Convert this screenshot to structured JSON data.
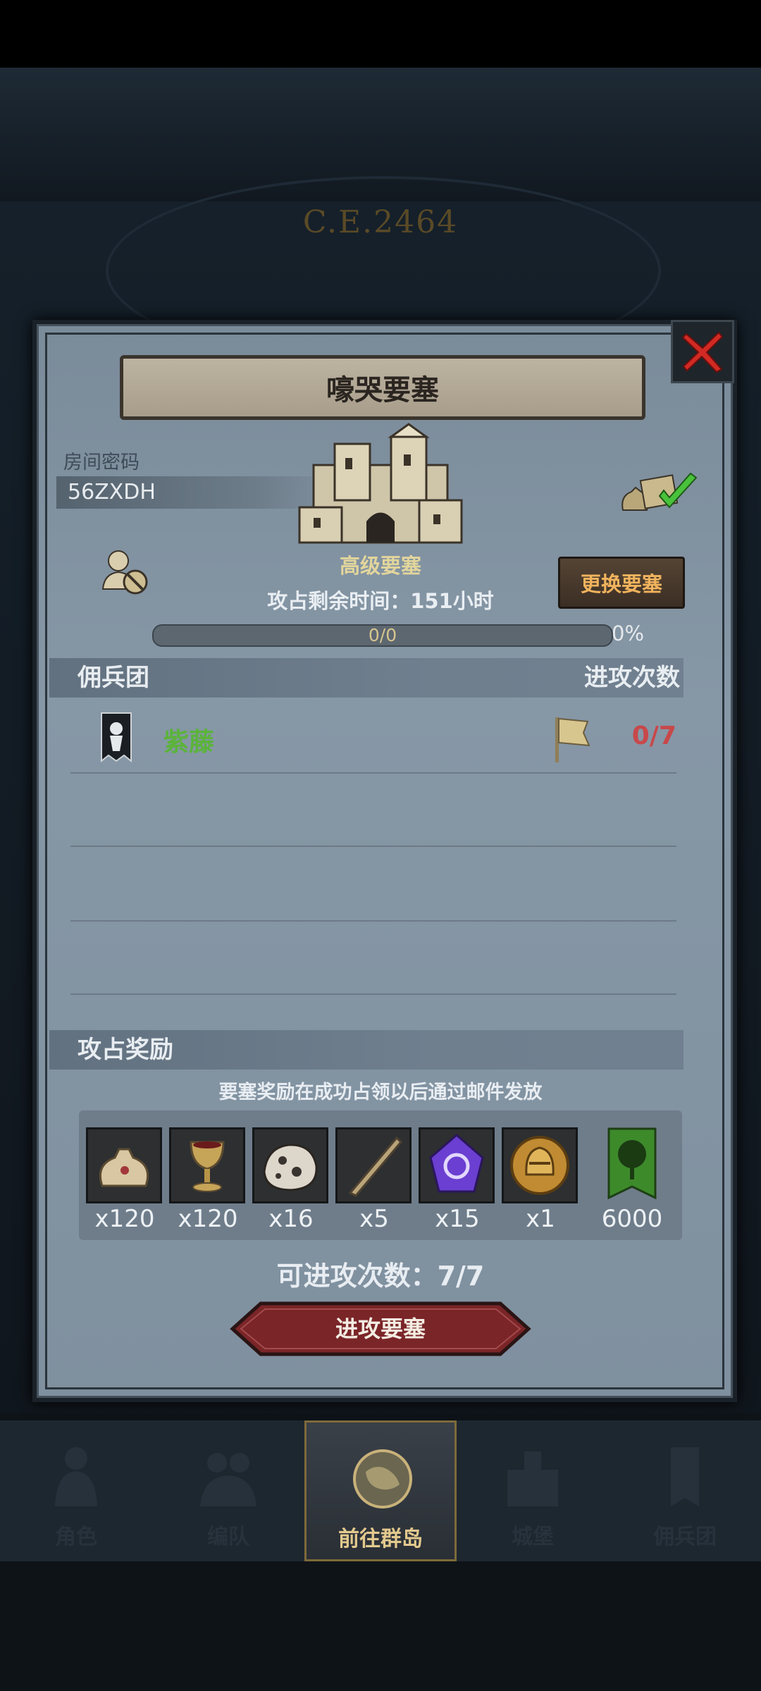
{
  "era": "C.E.2464",
  "dialog": {
    "title": "嚎哭要塞",
    "room_label": "房间密码",
    "room_code": "56ZXDH",
    "fort_level": "高级要塞",
    "remaining_time": "攻占剩余时间：151小时",
    "progress_text": "0/0",
    "progress_percent": "0%",
    "progress_value": 0,
    "change_button": "更换要塞",
    "mercenary_header": "佣兵团",
    "attacks_header": "进攻次数",
    "mercenary": {
      "name": "紫藤",
      "count": "0/7"
    },
    "reward_header": "攻占奖励",
    "reward_note": "要塞奖励在成功占领以后通过邮件发放",
    "rewards": [
      {
        "icon": "sack-icon",
        "qty": "x120"
      },
      {
        "icon": "goblet-icon",
        "qty": "x120"
      },
      {
        "icon": "ore-icon",
        "qty": "x16"
      },
      {
        "icon": "horn-icon",
        "qty": "x5"
      },
      {
        "icon": "purple-crystal-icon",
        "qty": "x15"
      },
      {
        "icon": "helmet-coin-icon",
        "qty": "x1"
      },
      {
        "icon": "tree-banner-icon",
        "qty": "6000"
      }
    ],
    "attack_count": "可进攻次数：7/7",
    "attack_button": "进攻要塞"
  },
  "nav": [
    {
      "label": "角色",
      "icon": "knight-icon",
      "active": false
    },
    {
      "label": "编队",
      "icon": "formation-icon",
      "active": false
    },
    {
      "label": "前往群岛",
      "icon": "globe-icon",
      "active": true
    },
    {
      "label": "城堡",
      "icon": "castle-icon",
      "active": false
    },
    {
      "label": "佣兵团",
      "icon": "mercenary-icon",
      "active": false
    }
  ],
  "colors": {
    "accent_gold": "#e2d59c",
    "merc_green": "#5bb33b",
    "attack_red": "#c8484a",
    "button_orange": "#f0b35d"
  }
}
